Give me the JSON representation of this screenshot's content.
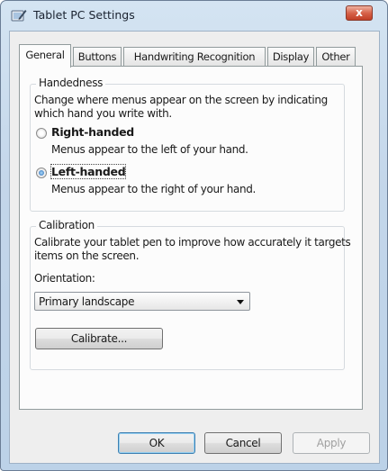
{
  "window": {
    "title": "Tablet PC Settings",
    "close_glyph": "x",
    "icon": "tablet-pen-icon"
  },
  "tabs": [
    {
      "label": "General",
      "active": true
    },
    {
      "label": "Buttons",
      "active": false
    },
    {
      "label": "Handwriting Recognition",
      "active": false
    },
    {
      "label": "Display",
      "active": false
    },
    {
      "label": "Other",
      "active": false
    }
  ],
  "handedness": {
    "title": "Handedness",
    "description_line1": "Change where menus appear on the screen by indicating",
    "description_line2": "which hand you write with.",
    "options": [
      {
        "label": "Right-handed",
        "hint": "Menus appear to the left of your hand.",
        "selected": false
      },
      {
        "label": "Left-handed",
        "hint": "Menus appear to the right of your hand.",
        "selected": true
      }
    ]
  },
  "calibration": {
    "title": "Calibration",
    "description_line1": "Calibrate your tablet pen to improve how accurately it targets",
    "description_line2": "items on the screen.",
    "orientation_label": "Orientation:",
    "orientation_value": "Primary landscape",
    "calibrate_button": "Calibrate..."
  },
  "footer": {
    "ok": "OK",
    "cancel": "Cancel",
    "apply": "Apply"
  }
}
